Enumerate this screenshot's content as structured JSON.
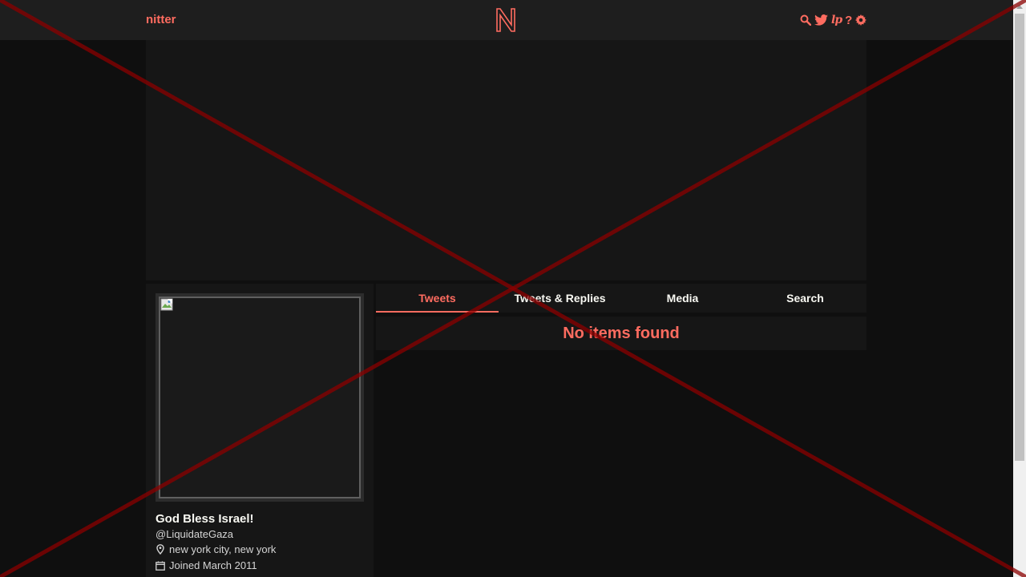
{
  "nav": {
    "brand": "nitter",
    "icons": [
      "search-icon",
      "twitter-bird-icon",
      "rss-icon",
      "help-icon",
      "gear-icon"
    ],
    "rss_label": "lp",
    "help_label": "?"
  },
  "profile": {
    "fullname": "God Bless Israel!",
    "username": "@LiquidateGaza",
    "location": "new york city, new york",
    "joined": "Joined March 2011",
    "location_icon": "location-pin-icon",
    "joined_icon": "calendar-icon"
  },
  "tabs": [
    {
      "label": "Tweets",
      "active": true
    },
    {
      "label": "Tweets & Replies",
      "active": false
    },
    {
      "label": "Media",
      "active": false
    },
    {
      "label": "Search",
      "active": false
    }
  ],
  "timeline": {
    "empty_message": "No items found"
  },
  "colors": {
    "accent": "#ff6c60",
    "background": "#0f0f0f",
    "panel": "#161616",
    "navbar": "#1e1e1e",
    "overlay_cross": "#8b0000"
  }
}
